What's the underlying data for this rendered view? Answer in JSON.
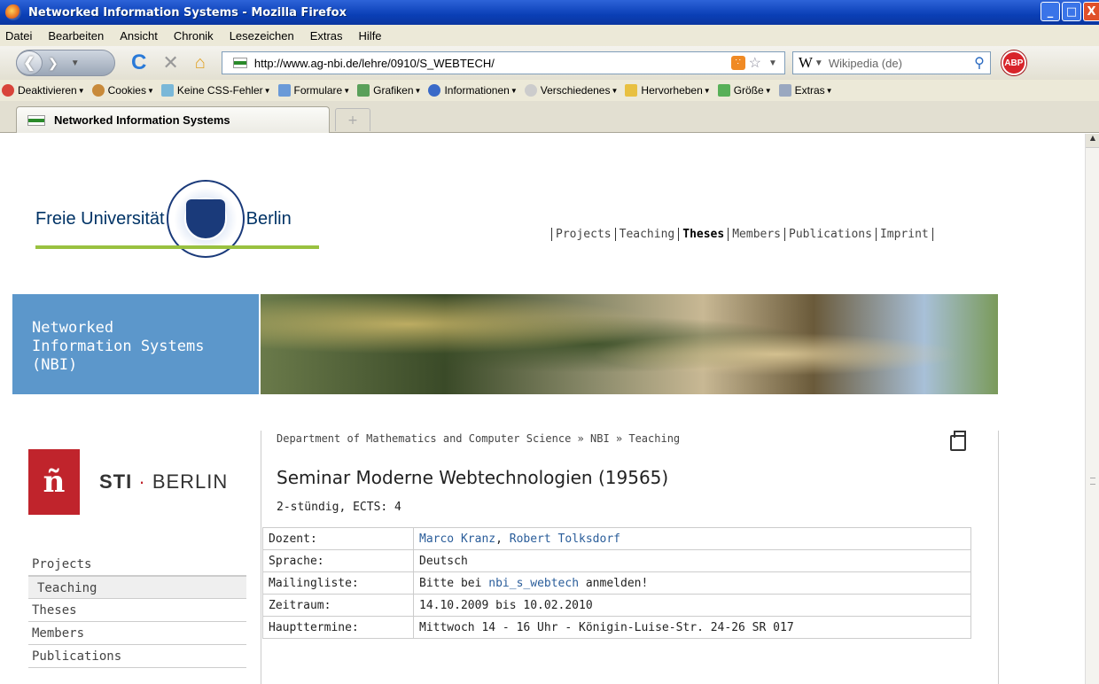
{
  "window": {
    "title": "Networked Information Systems - Mozilla Firefox",
    "min": "_",
    "max": "□",
    "close": "X"
  },
  "menu": [
    "Datei",
    "Bearbeiten",
    "Ansicht",
    "Chronik",
    "Lesezeichen",
    "Extras",
    "Hilfe"
  ],
  "nav": {
    "url": "http://www.ag-nbi.de/lehre/0910/S_WEBTECH/",
    "search_engine": "W",
    "search_placeholder": "Wikipedia (de)",
    "abp_label": "ABP"
  },
  "devbar": [
    "Deaktivieren",
    "Cookies",
    "Keine CSS-Fehler",
    "Formulare",
    "Grafiken",
    "Informationen",
    "Verschiedenes",
    "Hervorheben",
    "Größe",
    "Extras"
  ],
  "tab": {
    "title": "Networked Information Systems",
    "new_tab": "+"
  },
  "site": {
    "logo_left": "Freie Universität",
    "logo_right": "Berlin",
    "topnav": [
      "Projects",
      "Teaching",
      "Theses",
      "Members",
      "Publications",
      "Imprint"
    ],
    "topnav_active": "Theses",
    "group_name_1": "Networked",
    "group_name_2": "Information Systems",
    "group_name_3": "(NBI)",
    "sti_a": "STI",
    "sti_dot": "·",
    "sti_b": "BERLIN",
    "sidenav": [
      "Projects",
      "Teaching",
      "Theses",
      "Members",
      "Publications"
    ],
    "sidenav_selected": "Teaching"
  },
  "content": {
    "breadcrumb": "Department of Mathematics and Computer Science » NBI » Teaching",
    "title": "Seminar Moderne Webtechnologien (19565)",
    "subtitle": "2-stündig, ECTS: 4",
    "rows": [
      {
        "key": "Dozent:",
        "value_link1": "Marco Kranz",
        "value_sep": ", ",
        "value_link2": "Robert Tolksdorf"
      },
      {
        "key": "Sprache:",
        "value": "Deutsch"
      },
      {
        "key": "Mailingliste:",
        "value_pre": "Bitte bei ",
        "value_link": "nbi_s_webtech",
        "value_post": " anmelden!"
      },
      {
        "key": "Zeitraum:",
        "value": "14.10.2009 bis 10.02.2010"
      },
      {
        "key": "Haupttermine:",
        "value": "Mittwoch 14 - 16 Uhr - Königin-Luise-Str. 24-26 SR 017"
      }
    ]
  },
  "colors": {
    "titlebar": "#0a3fb6",
    "group_box": "#5c97cb",
    "fu_green": "#99c140",
    "sti_red": "#c0242c",
    "link": "#2a5d9a"
  }
}
